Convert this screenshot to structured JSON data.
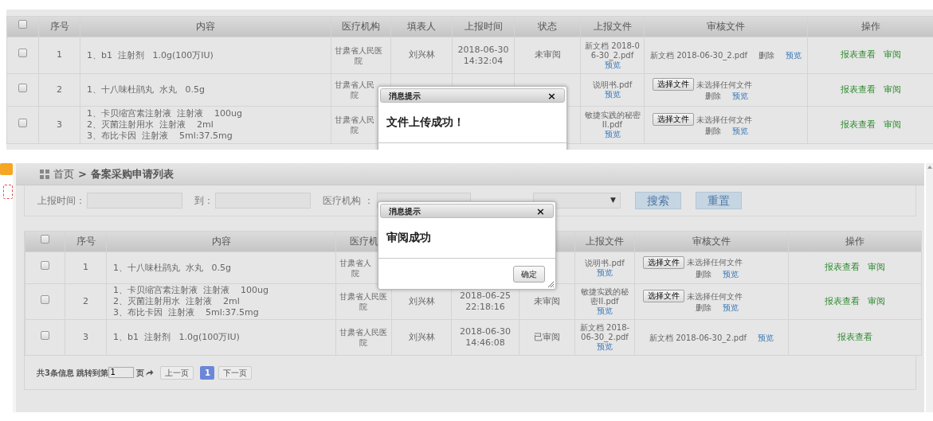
{
  "panels": [
    {
      "kind": "table_only",
      "table": {
        "select_all_checked": false,
        "columns": [
          "序号",
          "内容",
          "医疗机构",
          "填表人",
          "上报时间",
          "状态",
          "上报文件",
          "审核文件",
          "操作"
        ],
        "rows": [
          {
            "checked": false,
            "index": "1",
            "content": [
              "1、b1  注射剂   1.0g(100万IU)"
            ],
            "hospital": [
              "甘肃省人民医",
              "院"
            ],
            "reporter": "刘兴林",
            "time": [
              "2018-06-30",
              "14:32:04"
            ],
            "status": "未审阅",
            "report_file": {
              "name": "新文档 2018-06-30_2.pdf",
              "preview": "预览"
            },
            "review_file": {
              "kind": "uploaded",
              "name": "新文档 2018-06-30_2.pdf",
              "links": [
                {
                  "kind": "delete",
                  "label": "删除"
                },
                {
                  "kind": "preview",
                  "label": "预览"
                }
              ]
            },
            "actions": [
              "报表查看",
              "审阅"
            ]
          },
          {
            "checked": false,
            "index": "2",
            "content": [
              "1、十八味杜鹃丸  水丸   0.5g"
            ],
            "hospital": [
              "甘肃省人民",
              "院"
            ],
            "report_file": {
              "name": "说明书.pdf",
              "preview": "预览"
            },
            "review_file": {
              "kind": "chooser",
              "button": "选择文件",
              "note": "未选择任何文件",
              "links": [
                {
                  "kind": "delete",
                  "label": "删除"
                },
                {
                  "kind": "preview",
                  "label": "预览"
                }
              ]
            },
            "actions": [
              "报表查看",
              "审阅"
            ]
          },
          {
            "checked": false,
            "index": "3",
            "content": [
              "1、卡贝缩宫素注射液  注射液    100ug",
              "2、灭菌注射用水  注射液    2ml",
              "3、布比卡因  注射液    5ml:37.5mg"
            ],
            "hospital": [
              "甘肃省人民",
              "院"
            ],
            "report_file": {
              "name": "敏捷实践的秘密II.pdf",
              "preview": "预览"
            },
            "review_file": {
              "kind": "chooser",
              "button": "选择文件",
              "note": "未选择任何文件",
              "links": [
                {
                  "kind": "delete",
                  "label": "删除"
                },
                {
                  "kind": "preview",
                  "label": "预览"
                }
              ]
            },
            "actions": [
              "报表查看",
              "审阅"
            ]
          }
        ]
      },
      "dialog": {
        "title": "消息提示",
        "close": "×",
        "message": "文件上传成功！"
      }
    },
    {
      "kind": "full_page",
      "breadcrumb": {
        "home": "首页",
        "separator": ">",
        "current": "备案采购申请列表"
      },
      "filters": {
        "time_label": "上报时间：",
        "to_label": "到：",
        "hospital_label": "医疗机构 ：",
        "select_arrow": "▼",
        "search": "搜索",
        "reset": "重置"
      },
      "table": {
        "select_all_checked": false,
        "columns": [
          "序号",
          "内容",
          "医疗机",
          null,
          null,
          null,
          "上报文件",
          "审核文件",
          "操作"
        ],
        "rows": [
          {
            "checked": false,
            "index": "1",
            "content": [
              "1、十八味杜鹃丸  水丸   0.5g"
            ],
            "hospital": [
              "甘肃省人",
              "院"
            ],
            "report_file": {
              "name": "说明书.pdf",
              "preview": "预览"
            },
            "review_file": {
              "kind": "chooser",
              "button": "选择文件",
              "note": "未选择任何文件",
              "links": [
                {
                  "kind": "delete",
                  "label": "删除"
                },
                {
                  "kind": "preview",
                  "label": "预览"
                }
              ]
            },
            "actions": [
              "报表查看",
              "审阅"
            ]
          },
          {
            "checked": false,
            "index": "2",
            "content": [
              "1、卡贝缩宫素注射液  注射液    100ug",
              "2、灭菌注射用水  注射液    2ml",
              "3、布比卡因  注射液    5ml:37.5mg"
            ],
            "hospital": [
              "甘肃省人民医",
              "院"
            ],
            "reporter": "刘兴林",
            "time": [
              "2018-06-25",
              "22:18:16"
            ],
            "status": "未审阅",
            "report_file": {
              "name": "敏捷实践的秘密II.pdf",
              "preview": "预览"
            },
            "review_file": {
              "kind": "chooser",
              "button": "选择文件",
              "note": "未选择任何文件",
              "links": [
                {
                  "kind": "delete",
                  "label": "删除"
                },
                {
                  "kind": "preview",
                  "label": "预览"
                }
              ]
            },
            "actions": [
              "报表查看",
              "审阅"
            ]
          },
          {
            "checked": false,
            "index": "3",
            "content": [
              "1、b1  注射剂   1.0g(100万IU)"
            ],
            "hospital": [
              "甘肃省人民医",
              "院"
            ],
            "reporter": "刘兴林",
            "time": [
              "2018-06-30",
              "14:46:08"
            ],
            "status": "已审阅",
            "report_file": {
              "name": "新文档 2018-06-30_2.pdf",
              "preview": "预览"
            },
            "review_file": {
              "kind": "uploaded",
              "name": "新文档 2018-06-30_2.pdf",
              "links": [
                {
                  "kind": "preview",
                  "label": "预览"
                }
              ]
            },
            "actions": [
              "报表查看"
            ]
          }
        ]
      },
      "pagination": {
        "summary": "共3条信息 跳转到第",
        "page_value": "1",
        "page_unit": "页",
        "prev": "上一页",
        "pages": [
          {
            "label": "1",
            "selected": true
          }
        ],
        "next": "下一页"
      },
      "dialog": {
        "title": "消息提示",
        "close": "×",
        "message": "审阅成功",
        "ok": "确定"
      }
    }
  ]
}
